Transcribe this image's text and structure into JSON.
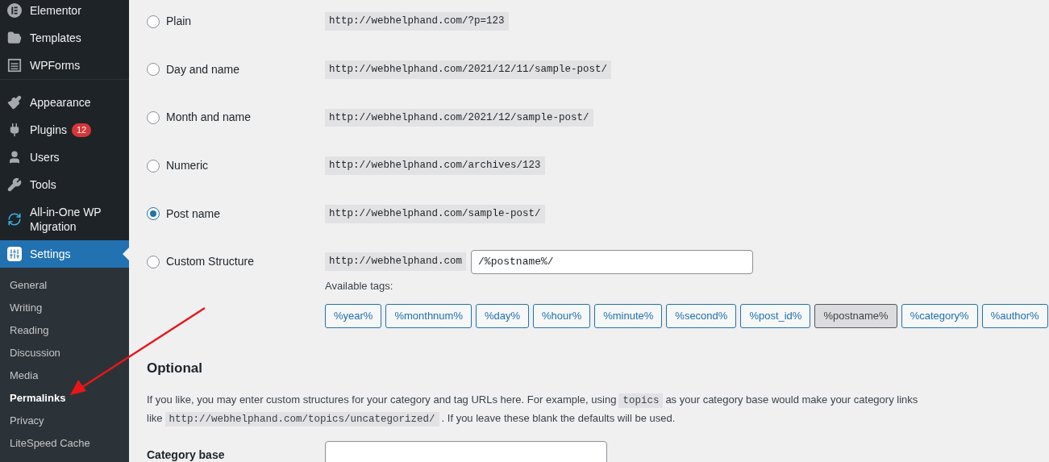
{
  "sidebar": {
    "items": [
      {
        "label": "Elementor",
        "selected": false
      },
      {
        "label": "Templates",
        "selected": false
      },
      {
        "label": "WPForms",
        "selected": false
      },
      {
        "label": "Appearance",
        "selected": false,
        "gap_before": true
      },
      {
        "label": "Plugins",
        "selected": false,
        "badge": "12"
      },
      {
        "label": "Users",
        "selected": false
      },
      {
        "label": "Tools",
        "selected": false
      },
      {
        "label": "All-in-One WP Migration",
        "selected": false
      },
      {
        "label": "Settings",
        "selected": true
      }
    ],
    "submenu": [
      {
        "label": "General",
        "selected": false
      },
      {
        "label": "Writing",
        "selected": false
      },
      {
        "label": "Reading",
        "selected": false
      },
      {
        "label": "Discussion",
        "selected": false
      },
      {
        "label": "Media",
        "selected": false
      },
      {
        "label": "Permalinks",
        "selected": true
      },
      {
        "label": "Privacy",
        "selected": false
      },
      {
        "label": "LiteSpeed Cache",
        "selected": false
      }
    ]
  },
  "permalink_options": [
    {
      "kind": "example",
      "label": "Plain",
      "selected": false,
      "example": "http://webhelphand.com/?p=123"
    },
    {
      "kind": "example",
      "label": "Day and name",
      "selected": false,
      "example": "http://webhelphand.com/2021/12/11/sample-post/"
    },
    {
      "kind": "example",
      "label": "Month and name",
      "selected": false,
      "example": "http://webhelphand.com/2021/12/sample-post/"
    },
    {
      "kind": "example",
      "label": "Numeric",
      "selected": false,
      "example": "http://webhelphand.com/archives/123"
    },
    {
      "kind": "example",
      "label": "Post name",
      "selected": true,
      "example": "http://webhelphand.com/sample-post/"
    },
    {
      "kind": "custom",
      "label": "Custom Structure",
      "selected": false,
      "example": "http://webhelphand.com",
      "value": "/%postname%/"
    }
  ],
  "available_tags": {
    "label": "Available tags:",
    "tags": [
      {
        "label": "%year%",
        "selected": false
      },
      {
        "label": "%monthnum%",
        "selected": false
      },
      {
        "label": "%day%",
        "selected": false
      },
      {
        "label": "%hour%",
        "selected": false
      },
      {
        "label": "%minute%",
        "selected": false
      },
      {
        "label": "%second%",
        "selected": false
      },
      {
        "label": "%post_id%",
        "selected": false
      },
      {
        "label": "%postname%",
        "selected": true
      },
      {
        "label": "%category%",
        "selected": false
      },
      {
        "label": "%author%",
        "selected": false
      }
    ]
  },
  "optional": {
    "heading": "Optional",
    "description": [
      {
        "kind": "text",
        "text": "If you like, you may enter custom structures for your category and tag URLs here. For example, using"
      },
      {
        "kind": "code",
        "text": "topics"
      },
      {
        "kind": "text",
        "text": "as your category base would make your category links like"
      },
      {
        "kind": "code",
        "text": "http://webhelphand.com/topics/uncategorized/"
      },
      {
        "kind": "text",
        "text": ". If you leave these blank the defaults will be used."
      }
    ],
    "fields": [
      {
        "label": "Category base"
      }
    ]
  }
}
